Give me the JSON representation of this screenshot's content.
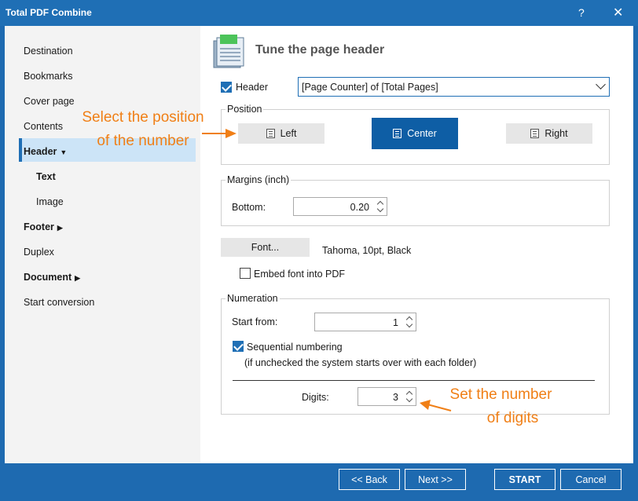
{
  "window": {
    "title": "Total PDF Combine",
    "help": "?",
    "close": "✕"
  },
  "sidebar": {
    "items": [
      {
        "label": "Destination"
      },
      {
        "label": "Bookmarks"
      },
      {
        "label": "Cover page"
      },
      {
        "label": "Contents"
      },
      {
        "label": "Header"
      },
      {
        "label": "Text"
      },
      {
        "label": "Image"
      },
      {
        "label": "Footer"
      },
      {
        "label": "Duplex"
      },
      {
        "label": "Document"
      },
      {
        "label": "Start conversion"
      }
    ],
    "selected": "Text"
  },
  "main": {
    "title": "Tune the page header",
    "header_check_label": "Header",
    "header_checked": true,
    "header_select_value": "[Page Counter] of [Total Pages]",
    "position": {
      "title": "Position",
      "left": "Left",
      "center": "Center",
      "right": "Right",
      "selected": "Center"
    },
    "margins": {
      "title": "Margins (inch)",
      "bottom_label": "Bottom:",
      "bottom_value": "0.20"
    },
    "font": {
      "button": "Font...",
      "value": "Tahoma, 10pt, Black",
      "embed_label": "Embed font into PDF",
      "embed_checked": false
    },
    "numeration": {
      "title": "Numeration",
      "start_label": "Start from:",
      "start_value": "1",
      "sequential_label": "Sequential numbering",
      "sequential_checked": true,
      "sequential_note": "(if unchecked the system starts over with each folder)",
      "digits_label": "Digits:",
      "digits_value": "3"
    }
  },
  "callouts": {
    "position_line1": "Select the position",
    "position_line2": "of the number",
    "digits_line1": "Set the number",
    "digits_line2": "of digits"
  },
  "footer": {
    "back": "<< Back",
    "next": "Next >>",
    "start": "START",
    "cancel": "Cancel"
  },
  "colors": {
    "accent": "#1f6fb5",
    "callout": "#f07f16",
    "selected_nav": "#cce4f7"
  }
}
